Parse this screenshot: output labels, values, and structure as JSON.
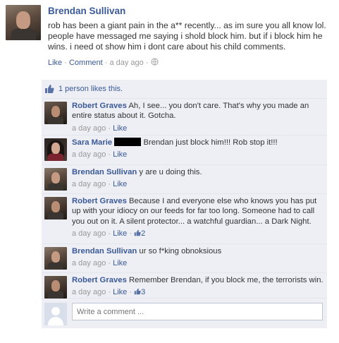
{
  "post": {
    "author": "Brendan Sullivan",
    "text": "rob has been a giant pain in the a** recently... as im sure you all know lol. people have messaged me saying i shold block him. but if i block him he wins. i need ot show him i dont care about his child comments.",
    "actions": {
      "like": "Like",
      "comment": "Comment",
      "time": "a day ago",
      "sep": "·"
    }
  },
  "likes": {
    "text": "1 person likes this."
  },
  "comments": [
    {
      "author": "Robert Graves",
      "text": "Ah, I see... you don't care. That's why you made an entire status about it. Gotcha.",
      "time": "a day ago",
      "like": "Like",
      "likes": ""
    },
    {
      "author": "Sara Marie",
      "text": "Brendan just block him!!! Rob stop it!!!",
      "time": "a day ago",
      "like": "Like",
      "likes": ""
    },
    {
      "author": "Brendan Sullivan",
      "text": "y are u doing this.",
      "time": "a day ago",
      "like": "Like",
      "likes": ""
    },
    {
      "author": "Robert Graves",
      "text": "Because I and everyone else who knows you has put up with your idiocy on our feeds for far too long. Someone had to call you out on it. A silent protector... a watchful guardian... a Dark Night.",
      "time": "a day ago",
      "like": "Like",
      "likes": "2"
    },
    {
      "author": "Brendan Sullivan",
      "text": "ur so f*king obnoksious",
      "time": "a day ago",
      "like": "Like",
      "likes": ""
    },
    {
      "author": "Robert Graves",
      "text": "Remember Brendan, if you block me, the terrorists win.",
      "time": "a day ago",
      "like": "Like",
      "likes": "3"
    }
  ],
  "composer": {
    "placeholder": "Write a comment ..."
  },
  "icons": {
    "like": "thumbs-up-icon",
    "globe": "globe-icon",
    "avatar_placeholder": "silhouette-icon"
  },
  "colors": {
    "link": "#3b5998",
    "panel": "#edeff4",
    "meta": "#999999"
  }
}
